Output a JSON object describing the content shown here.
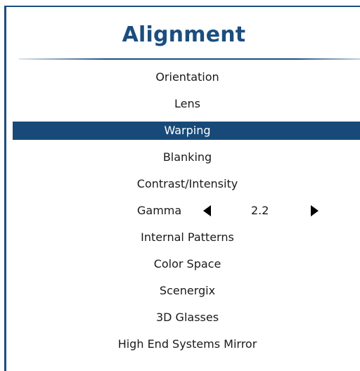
{
  "menu": {
    "title": "Alignment",
    "items": [
      {
        "label": "Orientation"
      },
      {
        "label": "Lens"
      },
      {
        "label": "Warping",
        "selected": true
      },
      {
        "label": "Blanking"
      },
      {
        "label": "Contrast/Intensity"
      },
      {
        "label": "Gamma",
        "value": "2.2"
      },
      {
        "label": "Internal Patterns"
      },
      {
        "label": "Color Space"
      },
      {
        "label": "Scenergix"
      },
      {
        "label": "3D Glasses"
      },
      {
        "label": "High End Systems Mirror"
      }
    ]
  },
  "colors": {
    "accent": "#1b4e7e",
    "selected_bg": "#174a79",
    "selected_text": "#ffffff",
    "text": "#1a1a1a"
  },
  "icons": {
    "decrease": "triangle-left-icon",
    "increase": "triangle-right-icon"
  }
}
